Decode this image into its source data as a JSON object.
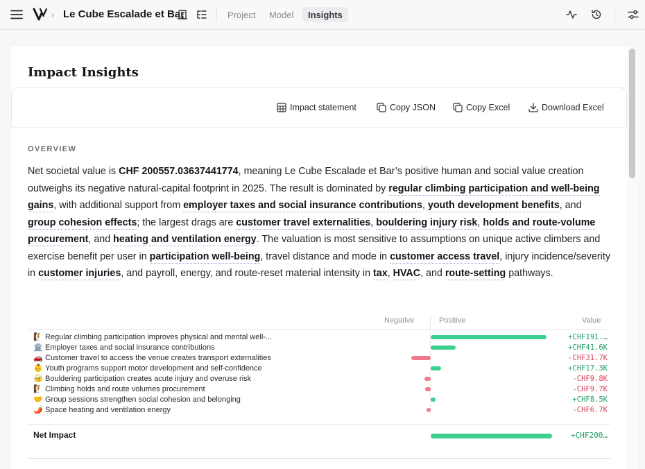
{
  "topbar": {
    "project_title": "Le Cube Escalade et Bar",
    "separator": "›",
    "tabs": [
      {
        "label": "Project",
        "active": false
      },
      {
        "label": "Model",
        "active": false
      },
      {
        "label": "Insights",
        "active": true
      }
    ],
    "icons": [
      "menu-icon",
      "app-logo-icon",
      "building-icon",
      "tree-list-icon",
      "activity-icon",
      "history-icon",
      "settings-sliders-icon"
    ]
  },
  "page": {
    "title": "Impact Insights"
  },
  "toolbar": {
    "impact_statement": "Impact statement",
    "copy_json": "Copy JSON",
    "copy_excel": "Copy Excel",
    "download_excel": "Download Excel"
  },
  "overview": {
    "label": "OVERVIEW",
    "t1": "Net societal value is ",
    "net_value": "CHF 200557.03637441774",
    "t2": ", meaning Le Cube Escalade et Bar’s positive human and social value creation outweighs its negative natural-capital footprint in 2025. The result is dominated by ",
    "l1": "regular climbing participation and well-being gains",
    "t3": ", with additional support from ",
    "l2": "employer taxes and social insurance contributions",
    "t4": ", ",
    "l3": "youth development benefits",
    "t5": ", and ",
    "l4": "group cohesion effects",
    "t6": "; the largest drags are ",
    "l5": "customer travel externalities",
    "t7": ", ",
    "l6": "bouldering injury risk",
    "t8": ", ",
    "l7": "holds and route-volume procurement",
    "t9": ", and ",
    "l8": "heating and ventilation energy",
    "t10": ". The valuation is most sensitive to assumptions on unique active climbers and exercise benefit per user in ",
    "l9": "participation well-being",
    "t11": ", travel distance and mode in ",
    "l10": "customer access travel",
    "t12": ", injury incidence/severity in ",
    "l11": "customer injuries",
    "t13": ", and payroll, energy, and route-reset material intensity in ",
    "l12": "tax",
    "t14": ", ",
    "l13": "HVAC",
    "t15": ", and ",
    "l14": "route-setting",
    "t16": " pathways."
  },
  "chart_data": {
    "type": "bar",
    "headers": {
      "negative": "Negative",
      "positive": "Positive",
      "value": "Value"
    },
    "rows": [
      {
        "emoji": "🧗",
        "label": "Regular climbing participation improves physical and mental well-...",
        "value": 191.0,
        "display": "+CHF191.…"
      },
      {
        "emoji": "🏛️",
        "label": "Employer taxes and social insurance contributions",
        "value": 41.6,
        "display": "+CHF41.6K"
      },
      {
        "emoji": "🚗",
        "label": "Customer travel to access the venue creates transport externalities",
        "value": -31.7,
        "display": "-CHF31.7K"
      },
      {
        "emoji": "👶",
        "label": "Youth programs support motor development and self-confidence",
        "value": 17.3,
        "display": "+CHF17.3K"
      },
      {
        "emoji": "🤕",
        "label": "Bouldering participation creates acute injury and overuse risk",
        "value": -9.8,
        "display": "-CHF9.8K"
      },
      {
        "emoji": "🧗",
        "label": "Climbing holds and route volumes procurement",
        "value": -9.7,
        "display": "-CHF9.7K"
      },
      {
        "emoji": "🤝",
        "label": "Group sessions strengthen social cohesion and belonging",
        "value": 8.5,
        "display": "+CHF8.5K"
      },
      {
        "emoji": "🌶️",
        "label": "Space heating and ventilation energy",
        "value": -6.7,
        "display": "-CHF6.7K"
      }
    ],
    "net": {
      "label": "Net Impact",
      "value": 200.6,
      "display": "+CHF200…"
    },
    "unit": "CHF thousand"
  }
}
